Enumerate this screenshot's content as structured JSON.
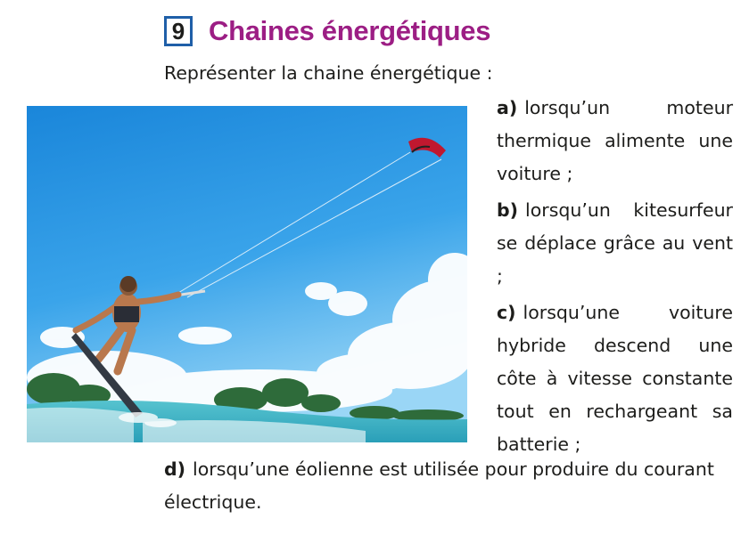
{
  "exercise": {
    "number": "9",
    "title": "Chaines énergétiques",
    "instruction": "Représenter la chaine énergétique :"
  },
  "items": [
    {
      "letter": "a)",
      "text": "lorsqu’un moteur thermique alimente une voiture ;"
    },
    {
      "letter": "b)",
      "text": "lorsqu’un kitesur­feur se déplace grâce au vent ;"
    },
    {
      "letter": "c)",
      "text": "lorsqu’une voiture hybride descend une côte à vitesse constante tout en rechargeant sa batterie ;"
    },
    {
      "letter": "d)",
      "text": "lorsqu’une éolienne est utilisée pour produire du cou­rant électrique."
    }
  ],
  "photo": {
    "subject": "kitesurfer-photo",
    "colors": {
      "sky_top": "#1e8fe0",
      "sky_bottom": "#8fd0f5",
      "cloud": "#ffffff",
      "sea": "#3fb4c8",
      "kite": "#c0182f"
    }
  },
  "theme": {
    "title_color": "#9c1e84",
    "box_border": "#1f5fa8"
  }
}
